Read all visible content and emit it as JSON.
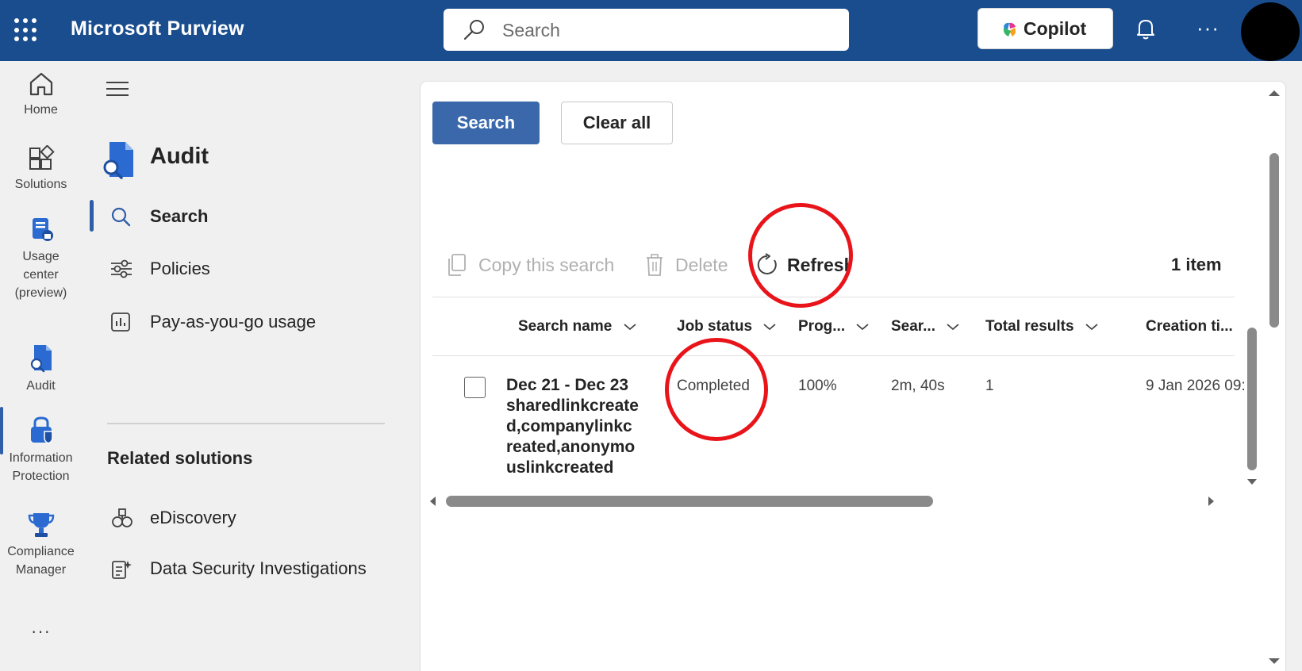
{
  "header": {
    "app_title": "Microsoft Purview",
    "search_placeholder": "Search",
    "copilot_label": "Copilot",
    "more_label": "···"
  },
  "rail": {
    "items": [
      {
        "label": "Home",
        "icon": "home-icon"
      },
      {
        "label": "Solutions",
        "icon": "solutions-icon"
      },
      {
        "label": "Usage center (preview)",
        "label_lines": [
          "Usage",
          "center",
          "(preview)"
        ],
        "icon": "usage-center-icon"
      },
      {
        "label": "Audit",
        "icon": "audit-icon",
        "active": true
      },
      {
        "label": "Information Protection",
        "label_lines": [
          "Information",
          "Protection"
        ],
        "icon": "information-protection-icon"
      },
      {
        "label": "Compliance Manager",
        "label_lines": [
          "Compliance",
          "Manager"
        ],
        "icon": "compliance-manager-icon"
      }
    ],
    "more_label": "···"
  },
  "nav": {
    "title": "Audit",
    "items": [
      {
        "label": "Search",
        "icon": "search-icon",
        "active": true
      },
      {
        "label": "Policies",
        "icon": "sliders-icon"
      },
      {
        "label": "Pay-as-you-go usage",
        "icon": "chart-icon"
      }
    ],
    "related_heading": "Related solutions",
    "related": [
      {
        "label": "eDiscovery",
        "icon": "ediscovery-icon"
      },
      {
        "label": "Data Security Investigations",
        "icon": "data-security-icon"
      }
    ]
  },
  "main": {
    "search_button": "Search",
    "clear_button": "Clear all",
    "toolbar": {
      "copy_label": "Copy this search",
      "delete_label": "Delete",
      "refresh_label": "Refresh",
      "item_count": "1 item"
    },
    "columns": [
      "Search name",
      "Job status",
      "Prog...",
      "Sear...",
      "Total results",
      "Creation ti..."
    ],
    "rows": [
      {
        "name_line1": "Dec 21 - Dec 23",
        "name_rest": "sharedlinkcreated,companylinkcreated,anonymouslinkcreated",
        "name_lines": [
          "sharedlinkcreate",
          "d,companylinkc",
          "reated,anonymo",
          "uslinkcreated"
        ],
        "job_status": "Completed",
        "progress": "100%",
        "search_time": "2m, 40s",
        "total_results": "1",
        "creation_time": "9 Jan 2026 09:"
      }
    ]
  },
  "colors": {
    "header_bg": "#194d8e",
    "primary_button": "#3a68aa",
    "annotation": "#e8141a"
  }
}
